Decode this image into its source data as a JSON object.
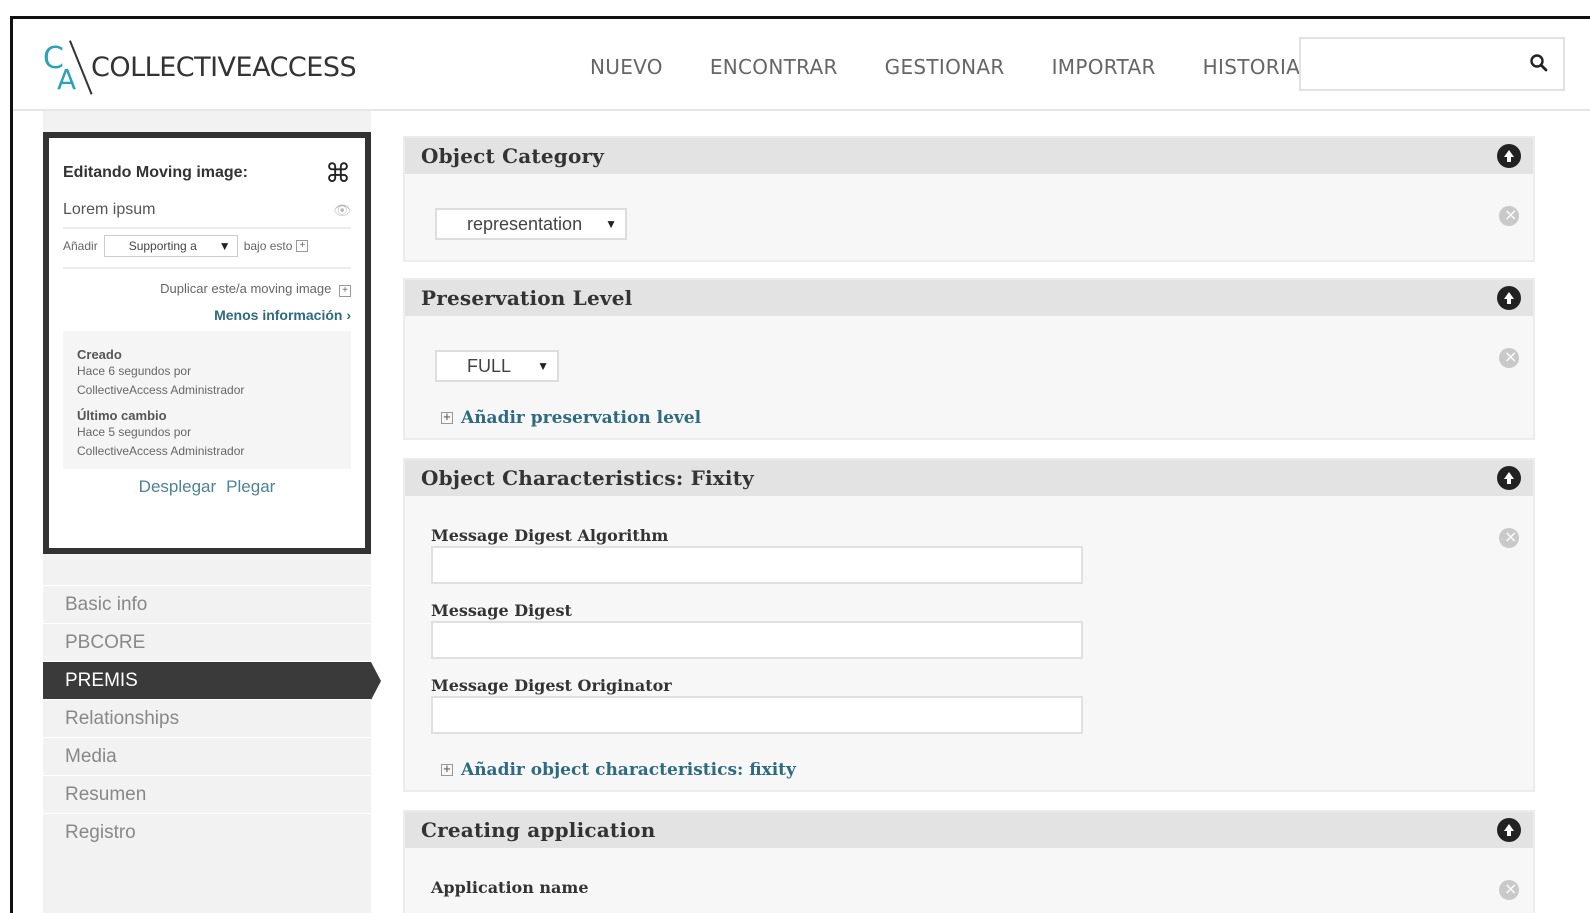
{
  "header": {
    "logo_text": "COLLECTIVEACCESS",
    "logo_mark_c": "C",
    "logo_mark_a": "A",
    "nav": [
      "NUEVO",
      "ENCONTRAR",
      "GESTIONAR",
      "IMPORTAR",
      "HISTORIA"
    ],
    "search": {
      "value": "",
      "placeholder": ""
    }
  },
  "info_box": {
    "title": "Editando Moving image:",
    "record_name": "Lorem ipsum",
    "add_label": "Añadir",
    "add_select_value": "Supporting a",
    "add_suffix": "bajo esto",
    "duplicate_label": "Duplicar este/a moving image",
    "less_info_label": "Menos información ›",
    "created_label": "Creado",
    "created_text_1": "Hace 6 segundos por",
    "created_text_2": "CollectiveAccess Administrador",
    "changed_label": "Último cambio",
    "changed_text_1": "Hace 5 segundos por",
    "changed_text_2": "CollectiveAccess Administrador",
    "expand_label": "Desplegar",
    "collapse_label": "Plegar"
  },
  "side_nav": {
    "items": [
      "Basic info",
      "PBCORE",
      "PREMIS",
      "Relationships",
      "Media",
      "Resumen",
      "Registro"
    ],
    "active": "PREMIS"
  },
  "panels": {
    "object_category": {
      "title": "Object Category",
      "select_value": "representation"
    },
    "preservation_level": {
      "title": "Preservation Level",
      "select_value": "FULL",
      "add_link": "Añadir preservation level"
    },
    "fixity": {
      "title": "Object Characteristics: Fixity",
      "fields": [
        "Message Digest Algorithm",
        "Message Digest",
        "Message Digest Originator"
      ],
      "add_link": "Añadir object characteristics: fixity"
    },
    "creating_application": {
      "title": "Creating application",
      "field": "Application name"
    }
  },
  "colors": {
    "logo_accent": "#2aa3b5",
    "link_blue": "#2e6a80",
    "active_nav_bg": "#3a3a3a",
    "panel_header_bg": "#e3e3e3"
  }
}
